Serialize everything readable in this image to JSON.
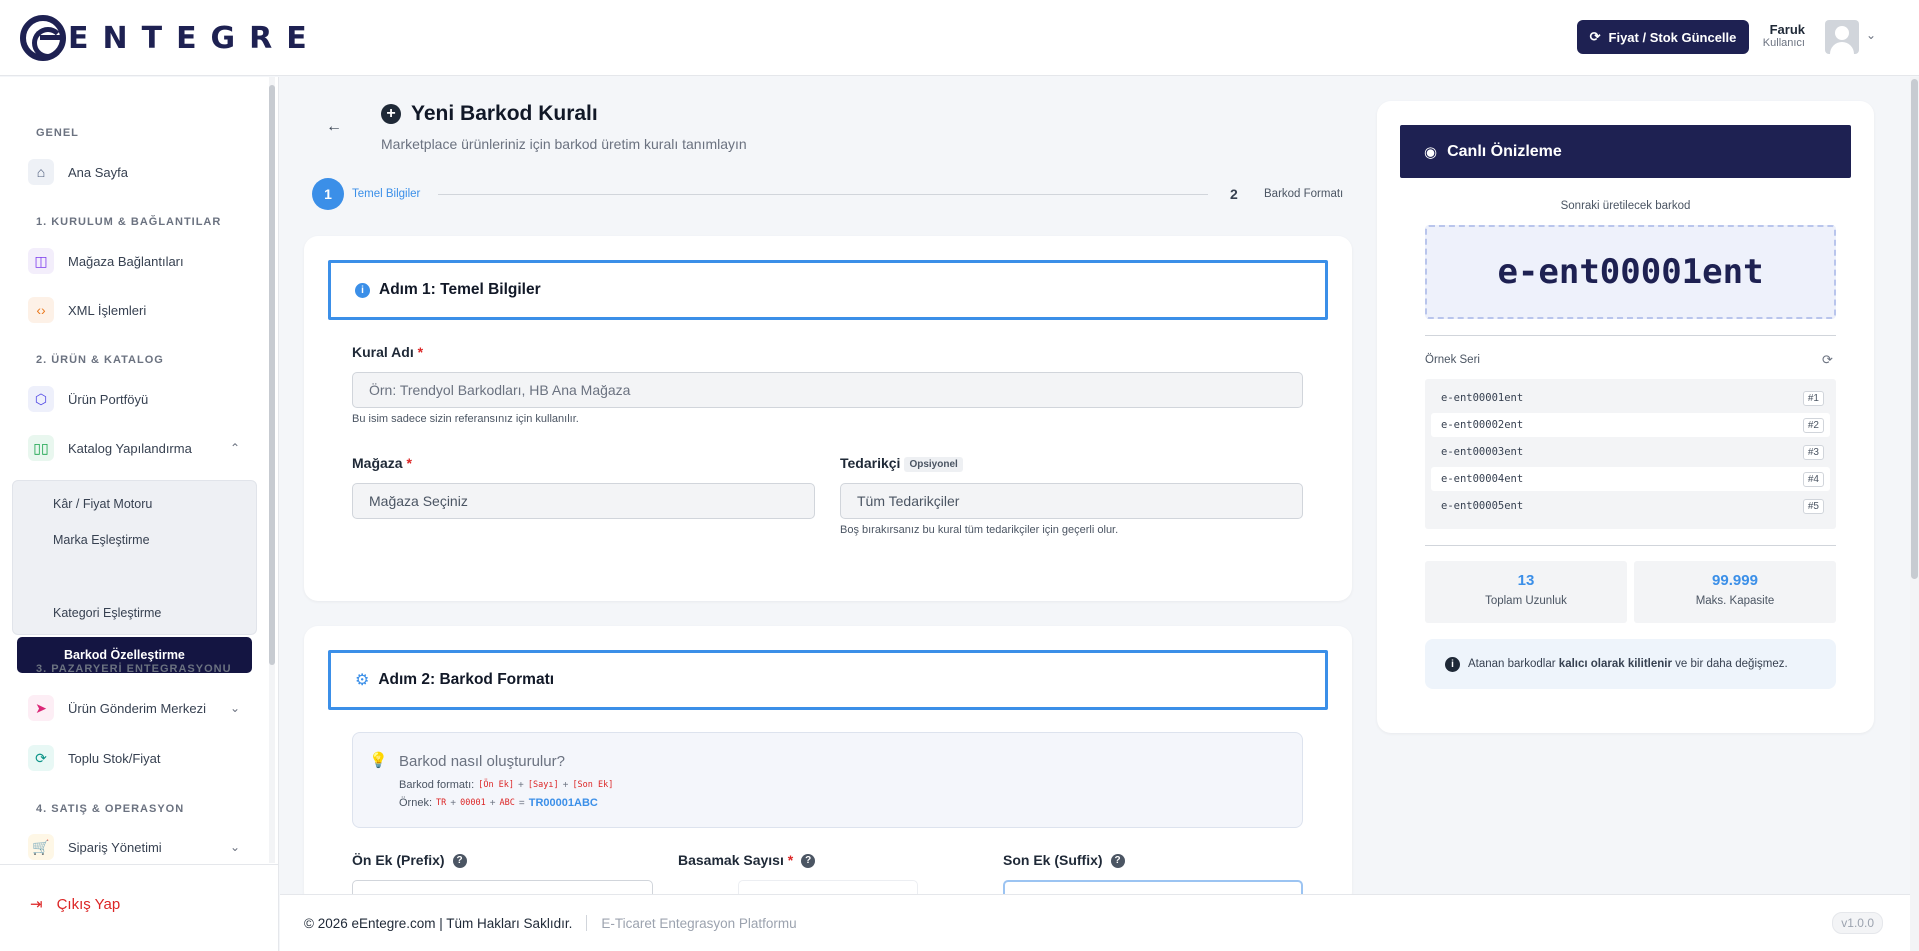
{
  "brand": {
    "logo_text": "ENTEGRE"
  },
  "header": {
    "update_button": "Fiyat / Stok Güncelle",
    "user_name": "Faruk",
    "user_role": "Kullanıcı"
  },
  "sidebar": {
    "sections": [
      "GENEL",
      "1. KURULUM & BAĞLANTILAR",
      "2. ÜRÜN & KATALOG",
      "3. PAZARYERİ ENTEGRASYONU",
      "4. SATIŞ & OPERASYON"
    ],
    "items": {
      "home": "Ana Sayfa",
      "stores": "Mağaza Bağlantıları",
      "xml": "XML İşlemleri",
      "portfolio": "Ürün Portföyü",
      "catalog": "Katalog Yapılandırma",
      "shipping": "Ürün Gönderim Merkezi",
      "bulk": "Toplu Stok/Fiyat",
      "orders": "Sipariş Yönetimi"
    },
    "subitems": [
      "Kâr / Fiyat Motoru",
      "Marka Eşleştirme",
      "Barkod Özelleştirme",
      "Kategori Eşleştirme"
    ],
    "logout": "Çıkış Yap"
  },
  "page": {
    "title": "Yeni Barkod Kuralı",
    "subtitle": "Marketplace ürünleriniz için barkod üretim kuralı tanımlayın",
    "step1_num": "1",
    "step1_label": "Temel Bilgiler",
    "step2_num": "2",
    "step2_label": "Barkod Formatı"
  },
  "step1": {
    "heading": "Adım 1: Temel Bilgiler",
    "rule_name_label": "Kural Adı",
    "rule_name_placeholder": "Örn: Trendyol Barkodları, HB Ana Mağaza",
    "rule_name_hint": "Bu isim sadece sizin referansınız için kullanılır.",
    "store_label": "Mağaza",
    "store_value": "Mağaza Seçiniz",
    "supplier_label": "Tedarikçi",
    "supplier_badge": "Opsiyonel",
    "supplier_value": "Tüm Tedarikçiler",
    "supplier_hint": "Boş bırakırsanız bu kural tüm tedarikçiler için geçerli olur."
  },
  "step2": {
    "heading": "Adım 2: Barkod Formatı",
    "howto_title": "Barkod nasıl oluşturulur?",
    "format_label": "Barkod formatı:",
    "format_parts": [
      "[Ön Ek]",
      "+",
      "[Sayı]",
      "+",
      "[Son Ek]"
    ],
    "example_label": "Örnek:",
    "example_parts": [
      "TR",
      "+",
      "00001",
      "+",
      "ABC",
      "="
    ],
    "example_result": "TR00001ABC",
    "prefix_label": "Ön Ek (Prefix)",
    "digits_label": "Basamak Sayısı",
    "suffix_label": "Son Ek (Suffix)"
  },
  "preview": {
    "heading": "Canlı Önizleme",
    "next_label": "Sonraki üretilecek barkod",
    "next_barcode": "e-ent00001ent",
    "series_label": "Örnek Seri",
    "series": [
      {
        "code": "e-ent00001ent",
        "index": "#1"
      },
      {
        "code": "e-ent00002ent",
        "index": "#2"
      },
      {
        "code": "e-ent00003ent",
        "index": "#3"
      },
      {
        "code": "e-ent00004ent",
        "index": "#4"
      },
      {
        "code": "e-ent00005ent",
        "index": "#5"
      }
    ],
    "total_length": "13",
    "total_length_label": "Toplam Uzunluk",
    "max_capacity": "99.999",
    "max_capacity_label": "Maks. Kapasite",
    "note_before": "Atanan barkodlar",
    "note_bold": "kalıcı olarak kilitlenir",
    "note_after": "ve bir daha değişmez."
  },
  "footer": {
    "copyright": "© 2026 eEntegre.com | Tüm Hakları Saklıdır.",
    "platform": "E-Ticaret Entegrasyon Platformu",
    "version": "v1.0.0"
  },
  "colors": {
    "brand_navy": "#1e2152",
    "accent_blue": "#3b8fe8",
    "danger_red": "#dc2626"
  }
}
